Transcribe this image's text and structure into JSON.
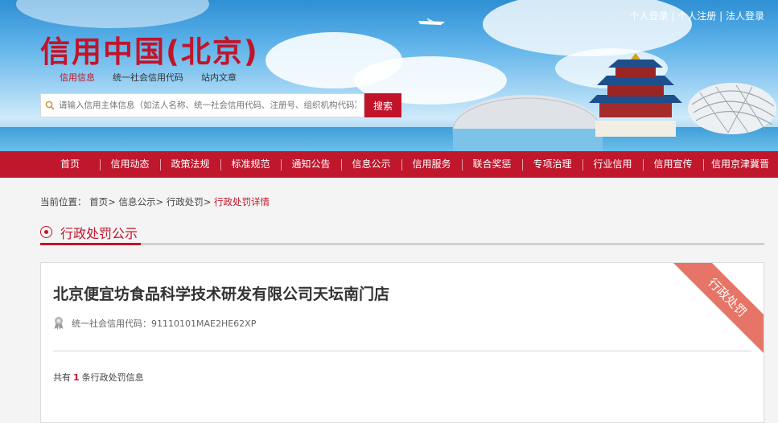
{
  "header": {
    "logo_text": "信用中国(北京)",
    "user_links": [
      "个人登录",
      "个人注册",
      "法人登录"
    ],
    "separator": "|",
    "search_tabs": [
      {
        "label": "信用信息",
        "active": true
      },
      {
        "label": "统一社会信用代码",
        "active": false
      },
      {
        "label": "站内文章",
        "active": false
      }
    ],
    "search": {
      "placeholder": "请输入信用主体信息（如法人名称、统一社会信用代码、注册号、组织机构代码）",
      "button_label": "搜索"
    }
  },
  "nav": {
    "items": [
      "首页",
      "信用动态",
      "政策法规",
      "标准规范",
      "通知公告",
      "信息公示",
      "信用服务",
      "联合奖惩",
      "专项治理",
      "行业信用",
      "信用宣传",
      "信用京津冀晋"
    ]
  },
  "breadcrumb": {
    "prefix": "当前位置：",
    "items": [
      "首页",
      "信息公示",
      "行政处罚"
    ],
    "separator": ">",
    "current": "行政处罚详情"
  },
  "section": {
    "title": "行政处罚公示"
  },
  "detail": {
    "company_name": "北京便宜坊食品科学技术研发有限公司天坛南门店",
    "credit_code_label": "统一社会信用代码：",
    "credit_code": "91110101MAE2HE62XP",
    "ribbon": "行政处罚",
    "count_prefix": "共有",
    "count": "1",
    "count_suffix": "条行政处罚信息"
  },
  "colors": {
    "brand_red": "#c1142a",
    "ribbon": "#e67567"
  }
}
